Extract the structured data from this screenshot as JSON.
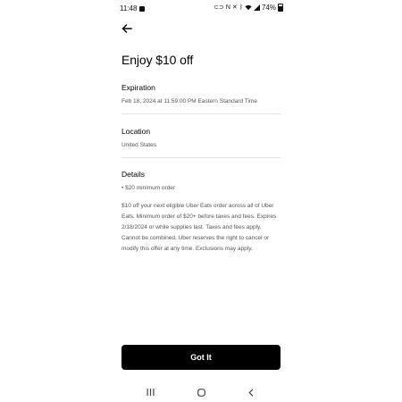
{
  "status_bar": {
    "time": "11:48",
    "battery": "74%",
    "icons": [
      "gallery-icon",
      "link-icon",
      "notes-icon",
      "mute-icon",
      "bluetooth-icon",
      "wifi-icon",
      "signal-icon",
      "battery-icon"
    ]
  },
  "header": {
    "back_icon": "arrow-left-icon"
  },
  "title": "Enjoy $10 off",
  "sections": {
    "expiration": {
      "label": "Expiration",
      "value": "Feb 18, 2024 at 11:59:00 PM Eastern Standard Time"
    },
    "location": {
      "label": "Location",
      "value": "United States"
    },
    "details": {
      "label": "Details",
      "bullet": "• $20 minimum order",
      "paragraph": "$10 off your next eligible Uber Eats order across all of Uber Eats. Minimum order of $20+ before taxes and fees. Expires 2/18/2024 or while supplies last. Taxes and fees apply. Cannot be combined. Uber reserves the right to cancel or modify this offer at any time. Exclusions may apply."
    }
  },
  "primary_button": {
    "label": "Got It"
  },
  "nav_bar": {
    "icons": [
      "recents-icon",
      "home-icon",
      "back-icon"
    ]
  },
  "colors": {
    "background": "#ffffff",
    "button_bg": "#000000",
    "button_text": "#ffffff",
    "secondary_text": "#555555",
    "divider": "#e2e2e2"
  }
}
